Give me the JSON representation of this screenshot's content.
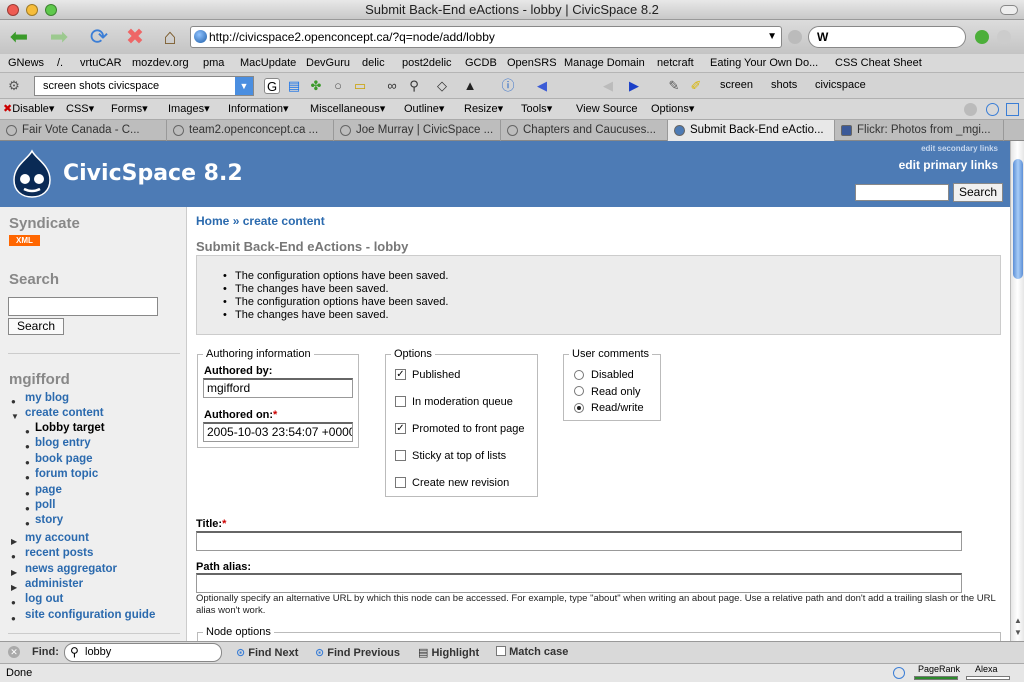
{
  "window": {
    "title": "Submit Back-End eActions - lobby | CivicSpace 8.2"
  },
  "navbar": {
    "url": "http://civicspace2.openconcept.ca/?q=node/add/lobby"
  },
  "bookmarks": [
    "GNews",
    "/.",
    "vrtuCAR",
    "mozdev.org",
    "pma",
    "MacUpdate",
    "DevGuru",
    "delic",
    "post2delic",
    "GCDB",
    "OpenSRS",
    "Manage Domain",
    "netcraft",
    "Eating Your Own Do...",
    "CSS Cheat Sheet"
  ],
  "google_toolbar": {
    "query": "screen shots civicspace",
    "terms": [
      "screen",
      "shots",
      "civicspace"
    ]
  },
  "webdev": {
    "items": [
      "Disable",
      "CSS",
      "Forms",
      "Images",
      "Information",
      "Miscellaneous",
      "Outline",
      "Resize",
      "Tools",
      "View Source",
      "Options"
    ]
  },
  "tabs": [
    {
      "label": "Fair Vote Canada - C..."
    },
    {
      "label": "team2.openconcept.ca ..."
    },
    {
      "label": "Joe Murray | CivicSpace ..."
    },
    {
      "label": "Chapters and Caucuses..."
    },
    {
      "label": "Submit Back-End eActio..."
    },
    {
      "label": "Flickr: Photos from _mgi..."
    }
  ],
  "header": {
    "site_name": "CivicSpace 8.2",
    "secondary_link": "edit secondary links",
    "primary_link": "edit primary links",
    "search_button": "Search"
  },
  "sidebar": {
    "syndicate_title": "Syndicate",
    "xml_badge": "XML",
    "search_title": "Search",
    "search_button": "Search",
    "user_title": "mgifford",
    "my_blog": "my blog",
    "create_content": "create content",
    "create_items": [
      "Lobby target",
      "blog entry",
      "book page",
      "forum topic",
      "page",
      "poll",
      "story"
    ],
    "my_account": "my account",
    "recent_posts": "recent posts",
    "news_aggregator": "news aggregator",
    "administer": "administer",
    "log_out": "log out",
    "site_guide": "site configuration guide"
  },
  "main": {
    "breadcrumb_home": "Home",
    "breadcrumb_sep": "»",
    "breadcrumb_current": "create content",
    "page_title": "Submit Back-End eActions - lobby",
    "messages": [
      "The configuration options have been saved.",
      "The changes have been saved.",
      "The configuration options have been saved.",
      "The changes have been saved."
    ],
    "authoring": {
      "legend": "Authoring information",
      "authored_by_label": "Authored by:",
      "authored_by": "mgifford",
      "authored_on_label": "Authored on:",
      "authored_on": "2005-10-03 23:54:07 +0000",
      "required_mark": "*"
    },
    "options": {
      "legend": "Options",
      "items": [
        {
          "label": "Published",
          "checked": true
        },
        {
          "label": "In moderation queue",
          "checked": false
        },
        {
          "label": "Promoted to front page",
          "checked": true
        },
        {
          "label": "Sticky at top of lists",
          "checked": false
        },
        {
          "label": "Create new revision",
          "checked": false
        }
      ]
    },
    "comments": {
      "legend": "User comments",
      "items": [
        {
          "label": "Disabled",
          "selected": false
        },
        {
          "label": "Read only",
          "selected": false
        },
        {
          "label": "Read/write",
          "selected": true
        }
      ]
    },
    "title_label": "Title:",
    "title_value": "",
    "path_label": "Path alias:",
    "path_value": "",
    "path_help": "Optionally specify an alternative URL by which this node can be accessed. For example, type \"about\" when writing an about page. Use a relative path and don't add a trailing slash or the URL alias won't work.",
    "node_options_legend": "Node options"
  },
  "findbar": {
    "label": "Find:",
    "query": "lobby",
    "find_next": "Find Next",
    "find_previous": "Find Previous",
    "highlight": "Highlight",
    "match_case": "Match case"
  },
  "statusbar": {
    "status": "Done",
    "pagerank": "PageRank",
    "alexa": "Alexa"
  },
  "colors": {
    "header_bg": "#4d7bb5",
    "link": "#2b6aae",
    "xml_badge": "#ff6600",
    "required": "#cc0000"
  }
}
